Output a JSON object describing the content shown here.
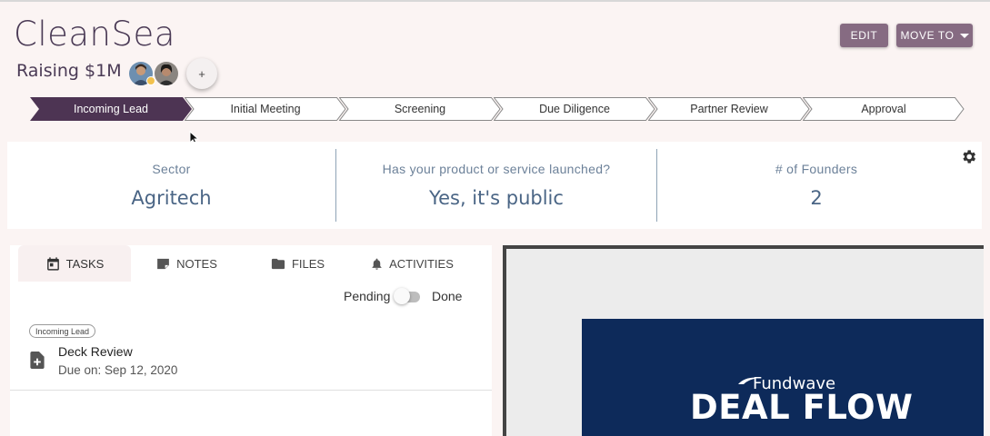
{
  "company": {
    "name": "CleanSea",
    "raising": "Raising $1M",
    "add_label": "+"
  },
  "actions": {
    "edit_label": "EDIT",
    "move_label": "MOVE TO"
  },
  "stages": [
    {
      "label": "Incoming Lead",
      "active": true
    },
    {
      "label": "Initial Meeting",
      "active": false
    },
    {
      "label": "Screening",
      "active": false
    },
    {
      "label": "Due Diligence",
      "active": false
    },
    {
      "label": "Partner Review",
      "active": false
    },
    {
      "label": "Approval",
      "active": false
    }
  ],
  "info": [
    {
      "label": "Sector",
      "value": "Agritech"
    },
    {
      "label": "Has your product or service launched?",
      "value": "Yes, it's public"
    },
    {
      "label": "# of Founders",
      "value": "2"
    }
  ],
  "tabs": [
    {
      "label": "TASKS",
      "icon": "calendar-icon",
      "active": true
    },
    {
      "label": "NOTES",
      "icon": "note-icon",
      "active": false
    },
    {
      "label": "FILES",
      "icon": "folder-icon",
      "active": false
    },
    {
      "label": "ACTIVITIES",
      "icon": "bell-icon",
      "active": false
    }
  ],
  "toggle": {
    "off_label": "Pending",
    "on_label": "Done",
    "state": "Pending"
  },
  "tasks": [
    {
      "stage": "Incoming Lead",
      "title": "Deck Review",
      "due": "Due on: Sep 12, 2020",
      "icon": "document-add-icon"
    }
  ],
  "preview": {
    "brand": "Fundwave",
    "title": "DEAL FLOW"
  },
  "colors": {
    "accent": "#866b82",
    "active_stage": "#4d3453",
    "slide_bg": "#0d2a5a",
    "info_text": "#4a6585"
  }
}
